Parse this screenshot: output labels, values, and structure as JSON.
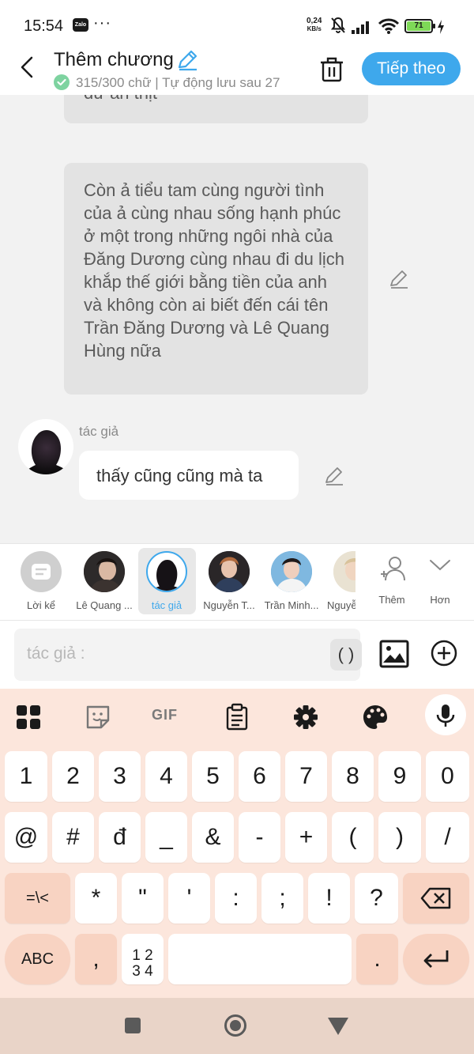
{
  "status_bar": {
    "time": "15:54",
    "zalo": "Zalo",
    "more": "···",
    "net_speed_value": "0,24",
    "net_speed_unit": "KB/s",
    "battery": "71"
  },
  "header": {
    "title": "Thêm chương",
    "subtitle": "315/300 chữ | Tự động lưu sau 27",
    "next_label": "Tiếp theo"
  },
  "chat": {
    "partial_text": "dư ăn thịt",
    "main_text": "Còn ả tiểu tam cùng người tình của ả cùng nhau sống hạnh phúc ở một trong những ngôi nhà của Đăng Dương  cùng nhau đi du lịch khắp thế giới bằng tiền của anh và không còn ai biết đến cái tên Trần Đăng Dương và Lê Quang Hùng nữa",
    "author_label": "tác giả",
    "author_text": "thấy cũng cũng mà ta"
  },
  "characters": [
    {
      "name": "Lời kể"
    },
    {
      "name": "Lê Quang ..."
    },
    {
      "name": "tác giả"
    },
    {
      "name": "Nguyễn T..."
    },
    {
      "name": "Trần Minh..."
    },
    {
      "name": "Nguyễ"
    }
  ],
  "char_actions": {
    "more_label": "Thêm",
    "expand_label": "Hơn"
  },
  "input": {
    "placeholder": "tác giả :",
    "paren_label": "( )"
  },
  "keyboard": {
    "row1": [
      "1",
      "2",
      "3",
      "4",
      "5",
      "6",
      "7",
      "8",
      "9",
      "0"
    ],
    "row2": [
      "@",
      "#",
      "đ",
      "_",
      "&",
      "-",
      "+",
      "(",
      ")",
      "/"
    ],
    "row3": [
      "=\\<",
      "*",
      "\"",
      "'",
      ":",
      ";",
      "!",
      "?"
    ],
    "abc": "ABC",
    "comma": ",",
    "numpad_line1": "1 2",
    "numpad_line2": "3 4",
    "period": ".",
    "gif": "GIF"
  },
  "colors": {
    "accent": "#3ea8ec",
    "keyboard_bg": "#fce6dc",
    "key_dark": "#f8d3c2"
  }
}
